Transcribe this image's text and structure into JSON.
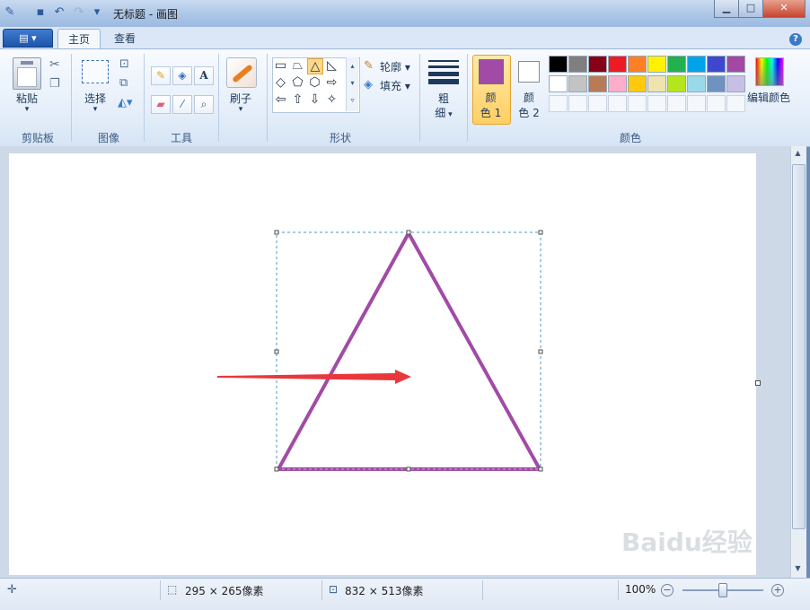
{
  "window": {
    "title": "无标题 - 画图"
  },
  "tabs": [
    {
      "label": "主页"
    },
    {
      "label": "查看"
    }
  ],
  "groups": {
    "clipboard": {
      "label": "剪贴板",
      "paste": "粘贴"
    },
    "image": {
      "label": "图像",
      "select": "选择"
    },
    "tools": {
      "label": "工具"
    },
    "brush": {
      "label": "刷子"
    },
    "shapes": {
      "label": "形状",
      "outline": "轮廓",
      "fill": "填充"
    },
    "size": {
      "label_top": "粗",
      "label_bottom": "细"
    },
    "colors": {
      "label": "颜色",
      "color1_top": "颜",
      "color1_bottom": "色 1",
      "color2_top": "颜",
      "color2_bottom": "色 2",
      "edit": "编辑颜色",
      "color1": "#a14ba6",
      "color2": "#ffffff",
      "palette_row1": [
        "#000000",
        "#7f7f7f",
        "#880015",
        "#ed1c24",
        "#ff7f27",
        "#fff200",
        "#22b14c",
        "#00a2e8",
        "#3f48cc",
        "#a349a4"
      ],
      "palette_row2": [
        "#ffffff",
        "#c3c3c3",
        "#b97a57",
        "#ffaec9",
        "#ffc90e",
        "#efe4b0",
        "#b5e61d",
        "#99d9ea",
        "#7092be",
        "#c8bfe7"
      ]
    }
  },
  "canvas": {
    "shape_color": "#a14ba6",
    "arrow_color": "#e8383d"
  },
  "status": {
    "selection_size": "295 × 265像素",
    "canvas_size": "832 × 513像素",
    "zoom": "100%"
  },
  "watermark": "Baidu经验"
}
